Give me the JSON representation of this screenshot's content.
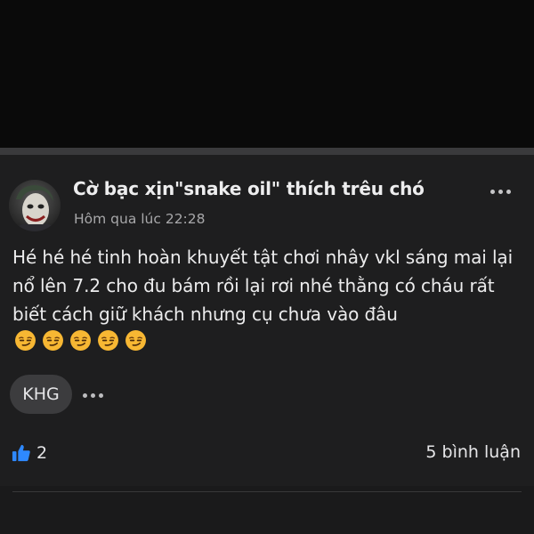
{
  "post": {
    "author_name": "Cờ bạc xịn\"snake oil\" thích trêu chó",
    "timestamp": "Hôm qua lúc 22:28",
    "body_text": "Hé hé hé tinh hoàn khuyết tật chơi nhây vkl sáng mai lại nổ lên 7.2 cho đu bám rồi lại rơi nhé thằng có cháu rất biết cách giữ khách nhưng cụ chưa vào đâu",
    "emojis": [
      "smirk-emoji",
      "smirk-emoji",
      "smirk-emoji",
      "smirk-emoji",
      "smirk-emoji"
    ],
    "more_icon": "more-horizontal-icon",
    "avatar_icon": "joker-avatar"
  },
  "reactions": {
    "chip_label": "KHG",
    "more_icon": "more-horizontal-icon"
  },
  "footer": {
    "like_icon": "thumbs-up-icon",
    "like_count": "2",
    "comments_label": "5 bình luận"
  },
  "colors": {
    "background": "#0f0f10",
    "card": "#1e1e1f",
    "like_blue": "#2e89ff",
    "emoji_yellow": "#f7b733"
  }
}
